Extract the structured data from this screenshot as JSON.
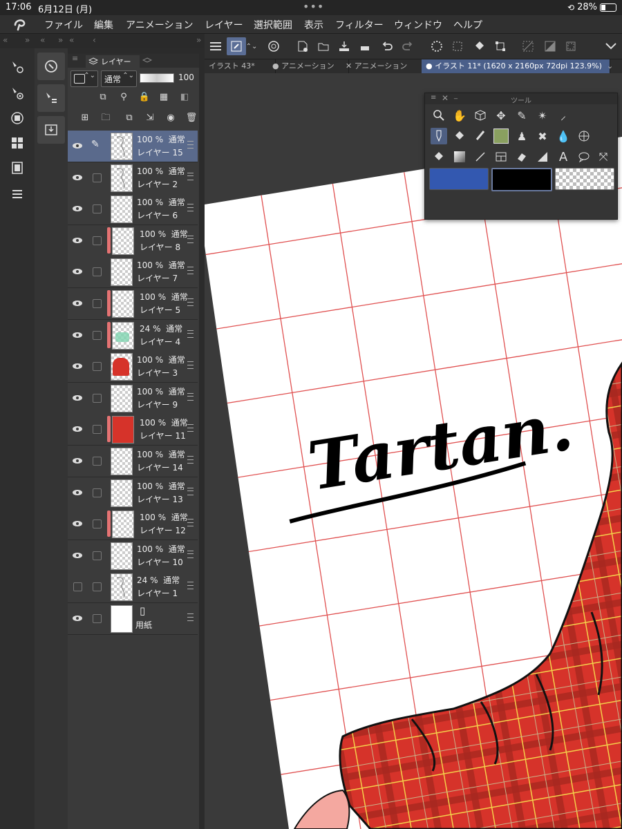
{
  "status": {
    "time": "17:06",
    "date": "6月12日 (月)",
    "battery": "28%",
    "battery_fraction": 0.28
  },
  "menu": [
    "ファイル",
    "編集",
    "アニメーション",
    "レイヤー",
    "選択範囲",
    "表示",
    "フィルター",
    "ウィンドウ",
    "ヘルプ"
  ],
  "layer_panel": {
    "tab_label": "レイヤー",
    "blend_mode": "通常",
    "opacity_value": "100",
    "layers": [
      {
        "opacity": "100 %",
        "mode": "通常",
        "name": "レイヤー 15",
        "thumb": "sketch",
        "redbar": false,
        "visible": true,
        "selected": true,
        "pen": true
      },
      {
        "opacity": "100 %",
        "mode": "通常",
        "name": "レイヤー 2",
        "thumb": "sketch",
        "redbar": false,
        "visible": true
      },
      {
        "opacity": "100 %",
        "mode": "通常",
        "name": "レイヤー 6",
        "thumb": "transparent",
        "redbar": false,
        "visible": true
      },
      {
        "opacity": "100 %",
        "mode": "通常",
        "name": "レイヤー 8",
        "thumb": "transparent",
        "redbar": true,
        "visible": true
      },
      {
        "opacity": "100 %",
        "mode": "通常",
        "name": "レイヤー 7",
        "thumb": "transparent",
        "redbar": false,
        "visible": true
      },
      {
        "opacity": "100 %",
        "mode": "通常",
        "name": "レイヤー 5",
        "thumb": "transparent",
        "redbar": true,
        "visible": true
      },
      {
        "opacity": "24 %",
        "mode": "通常",
        "name": "レイヤー 4",
        "thumb": "green",
        "redbar": true,
        "visible": true
      },
      {
        "opacity": "100 %",
        "mode": "通常",
        "name": "レイヤー 3",
        "thumb": "redfig",
        "redbar": false,
        "visible": true
      },
      {
        "opacity": "100 %",
        "mode": "通常",
        "name": "レイヤー 9",
        "thumb": "transparent",
        "redbar": false,
        "visible": true
      },
      {
        "opacity": "100 %",
        "mode": "通常",
        "name": "レイヤー 11",
        "thumb": "red",
        "redbar": true,
        "visible": true
      },
      {
        "opacity": "100 %",
        "mode": "通常",
        "name": "レイヤー 14",
        "thumb": "transparent",
        "redbar": false,
        "visible": true
      },
      {
        "opacity": "100 %",
        "mode": "通常",
        "name": "レイヤー 13",
        "thumb": "transparent",
        "redbar": false,
        "visible": true
      },
      {
        "opacity": "100 %",
        "mode": "通常",
        "name": "レイヤー 12",
        "thumb": "transparent",
        "redbar": true,
        "visible": true
      },
      {
        "opacity": "100 %",
        "mode": "通常",
        "name": "レイヤー 10",
        "thumb": "transparent",
        "redbar": false,
        "visible": true
      },
      {
        "opacity": "24 %",
        "mode": "通常",
        "name": "レイヤー 1",
        "thumb": "sketch",
        "redbar": false,
        "visible": false
      },
      {
        "opacity": "",
        "mode": "",
        "name": "用紙",
        "thumb": "white",
        "redbar": false,
        "visible": true,
        "paper": true
      }
    ]
  },
  "doc_tabs": [
    {
      "label": "イラスト 43*",
      "prefix": "",
      "active": false
    },
    {
      "label": "アニメーション",
      "prefix": "●",
      "active": false
    },
    {
      "label": "アニメーション",
      "prefix": "✕",
      "active": false
    },
    {
      "label": "イラスト 11* (1620 x 2160px 72dpi 123.9%)",
      "prefix": "●",
      "active": true
    }
  ],
  "tool_palette": {
    "title": "ツール",
    "swatches": {
      "main": "#3358b0",
      "sub": "#000000"
    }
  },
  "canvas": {
    "logo_text": "Tartan."
  },
  "colors": {
    "accent": "#4e5f82",
    "grid": "#e05050",
    "tartan": "#d6332a"
  }
}
